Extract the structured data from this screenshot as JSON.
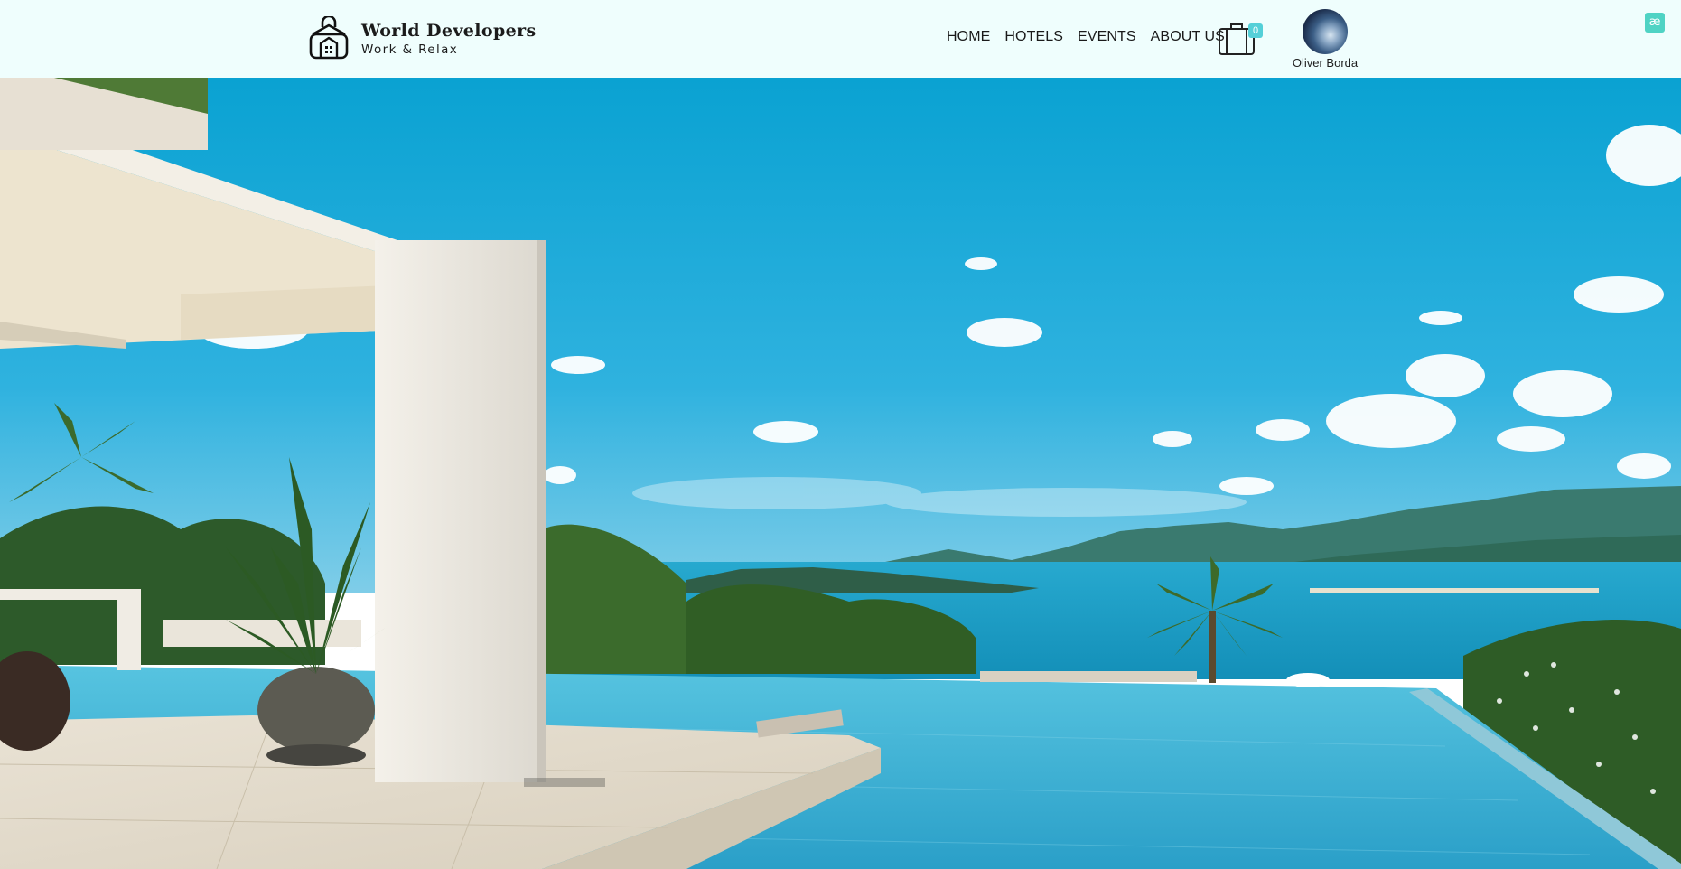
{
  "brand": {
    "title": "World Developers",
    "tagline": "Work & Relax",
    "icon": "suitcase-house-icon"
  },
  "nav": {
    "items": [
      {
        "label": "HOME"
      },
      {
        "label": "HOTELS"
      },
      {
        "label": "EVENTS"
      },
      {
        "label": "ABOUT US"
      }
    ]
  },
  "cart": {
    "icon": "suitcase-cart-icon",
    "count": "0"
  },
  "user": {
    "name": "Oliver Borda"
  },
  "corner_logo": {
    "glyph": "æ"
  },
  "hero": {
    "description_icon": "hero-image"
  },
  "colors": {
    "header_bg": "#effefd",
    "accent": "#54d0d8",
    "sky": "#1da6d6",
    "sea": "#1795bd",
    "pool": "#3fb4d6"
  }
}
